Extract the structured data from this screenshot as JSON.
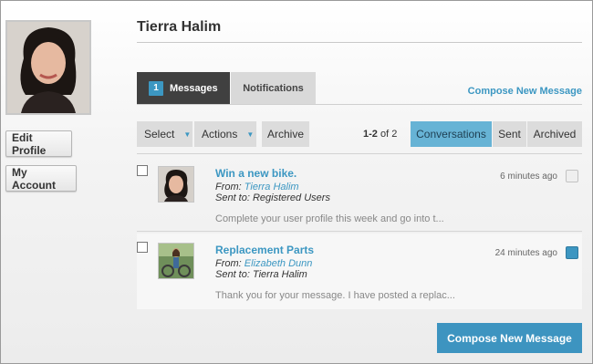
{
  "user": {
    "name": "Tierra Halim"
  },
  "sidebar": {
    "edit_profile": "Edit Profile",
    "my_account": "My Account"
  },
  "tabs": {
    "messages": {
      "label": "Messages",
      "count": "1"
    },
    "notifications": {
      "label": "Notifications"
    }
  },
  "compose_link": "Compose New Message",
  "toolbar": {
    "select": "Select",
    "actions": "Actions",
    "archive": "Archive",
    "pager_range": "1-2",
    "pager_of": "of 2",
    "views": {
      "conversations": "Conversations",
      "sent": "Sent",
      "archived": "Archived"
    }
  },
  "messages": [
    {
      "subject": "Win a new bike.",
      "from_label": "From:",
      "from": "Tierra Halim",
      "sent_to": "Sent to: Registered Users",
      "preview": "Complete your user profile this week and go into t...",
      "time": "6 minutes ago",
      "flagged": false
    },
    {
      "subject": "Replacement Parts",
      "from_label": "From:",
      "from": "Elizabeth Dunn",
      "sent_to": "Sent to: Tierra Halim",
      "preview": "Thank you for your message. I have posted a replac...",
      "time": "24 minutes ago",
      "flagged": true
    }
  ],
  "compose_button": "Compose New Message",
  "colors": {
    "accent": "#3c97c2",
    "dark_tab": "#404040",
    "active_view": "#67b3d5"
  }
}
